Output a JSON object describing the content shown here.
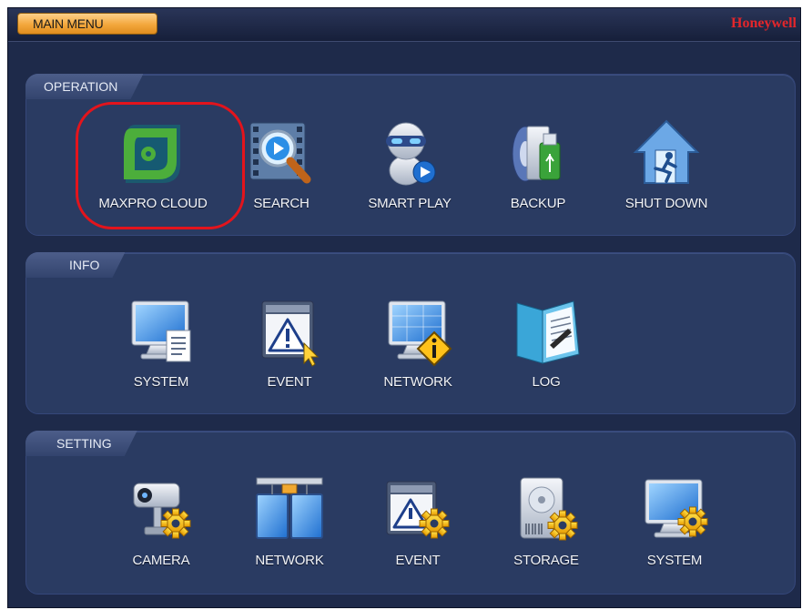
{
  "title_bar": {
    "menu_label": "MAIN MENU",
    "brand": "Honeywell"
  },
  "sections": {
    "operation": {
      "title": "OPERATION",
      "items": [
        {
          "label": "MAXPRO CLOUD",
          "icon": "maxpro-cloud-icon"
        },
        {
          "label": "SEARCH",
          "icon": "search-icon"
        },
        {
          "label": "SMART PLAY",
          "icon": "smart-play-icon"
        },
        {
          "label": "BACKUP",
          "icon": "backup-icon"
        },
        {
          "label": "SHUT DOWN",
          "icon": "shut-down-icon"
        }
      ]
    },
    "info": {
      "title": "INFO",
      "items": [
        {
          "label": "SYSTEM",
          "icon": "system-info-icon"
        },
        {
          "label": "EVENT",
          "icon": "event-info-icon"
        },
        {
          "label": "NETWORK",
          "icon": "network-info-icon"
        },
        {
          "label": "LOG",
          "icon": "log-icon"
        }
      ]
    },
    "setting": {
      "title": "SETTING",
      "items": [
        {
          "label": "CAMERA",
          "icon": "camera-settings-icon"
        },
        {
          "label": "NETWORK",
          "icon": "network-settings-icon"
        },
        {
          "label": "EVENT",
          "icon": "event-settings-icon"
        },
        {
          "label": "STORAGE",
          "icon": "storage-settings-icon"
        },
        {
          "label": "SYSTEM",
          "icon": "system-settings-icon"
        }
      ]
    }
  },
  "highlighted_item": "MAXPRO CLOUD",
  "colors": {
    "background": "#1e2a4a",
    "panel": "#2a3b62",
    "accent": "#f3a73c",
    "brand": "#e3262b",
    "highlight": "#e3141c"
  }
}
